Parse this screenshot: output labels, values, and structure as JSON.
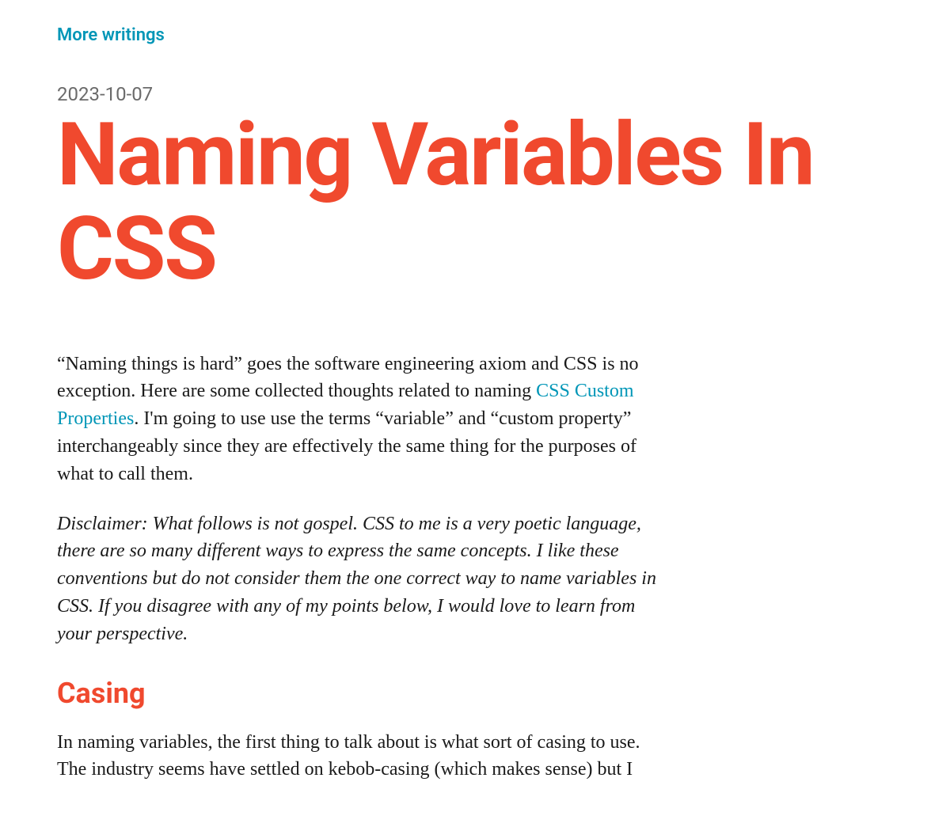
{
  "nav": {
    "more_writings": "More writings"
  },
  "article": {
    "date": "2023-10-07",
    "title": "Naming Variables In CSS",
    "intro_before_link": "“Naming things is hard” goes the software engineering axiom and CSS is no exception. Here are some collected thoughts related to naming ",
    "intro_link_text": "CSS Custom Properties",
    "intro_after_link": ". I'm going to use use the terms “variable” and “custom property” interchangeably since they are effectively the same thing for the purposes of what to call them.",
    "disclaimer": "Disclaimer: What follows is not gospel. CSS to me is a very poetic language, there are so many different ways to express the same concepts. I like these conventions but do not consider them the one correct way to name variables in CSS. If you disagree with any of my points below, I would love to learn from your perspective.",
    "section_heading": "Casing",
    "section_body": "In naming variables, the first thing to talk about is what sort of casing to use. The industry seems have settled on kebob-casing (which makes sense) but I"
  },
  "colors": {
    "accent": "#f0492e",
    "link": "#0096b7",
    "muted": "#6b6b6b"
  }
}
